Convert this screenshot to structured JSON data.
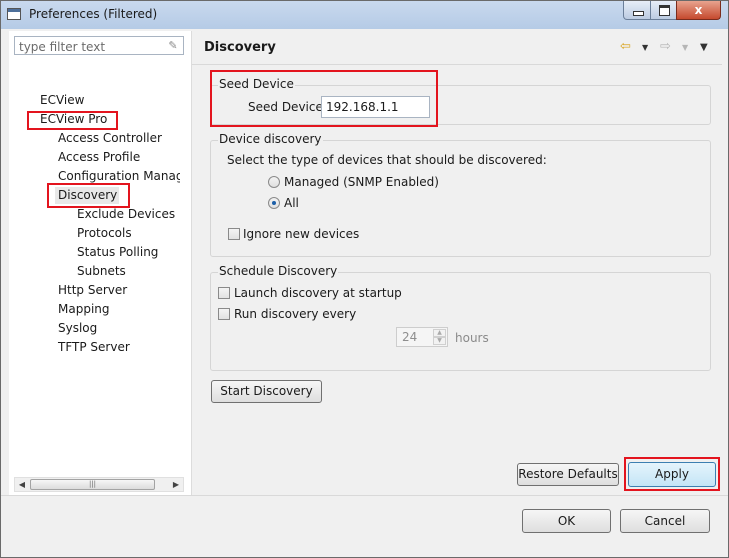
{
  "window": {
    "title": "Preferences (Filtered)",
    "close_glyph": "x"
  },
  "sidebar": {
    "filter_placeholder": "type filter text",
    "items": [
      {
        "label": "ECView"
      },
      {
        "label": "ECView Pro"
      },
      {
        "label": "Access Controller"
      },
      {
        "label": "Access Profile"
      },
      {
        "label": "Configuration Manag"
      },
      {
        "label": "Discovery"
      },
      {
        "label": "Exclude Devices"
      },
      {
        "label": "Protocols"
      },
      {
        "label": "Status Polling"
      },
      {
        "label": "Subnets"
      },
      {
        "label": "Http Server"
      },
      {
        "label": "Mapping"
      },
      {
        "label": "Syslog"
      },
      {
        "label": "TFTP Server"
      }
    ],
    "selected": "Discovery"
  },
  "page": {
    "title": "Discovery",
    "nav_icons": [
      "back-arrow-icon",
      "dropdown-icon",
      "forward-arrow-icon",
      "dropdown-icon",
      "view-menu-icon"
    ],
    "seed_device": {
      "group_title": "Seed Device",
      "label": "Seed Device",
      "value": "192.168.1.1"
    },
    "device_discovery": {
      "group_title": "Device discovery",
      "prompt": "Select the type of devices that should be discovered:",
      "options": [
        {
          "label": "Managed (SNMP Enabled)",
          "selected": false
        },
        {
          "label": "All",
          "selected": true
        }
      ],
      "ignore_new_devices": {
        "label": "Ignore new devices",
        "checked": false
      }
    },
    "schedule_discovery": {
      "group_title": "Schedule Discovery",
      "launch_at_startup": {
        "label": "Launch discovery at startup",
        "checked": false
      },
      "run_every": {
        "label": "Run discovery every",
        "checked": false
      },
      "interval_value": "24",
      "interval_unit": "hours"
    },
    "start_discovery_label": "Start Discovery",
    "restore_defaults_label": "Restore Defaults",
    "apply_label": "Apply"
  },
  "footer": {
    "ok_label": "OK",
    "cancel_label": "Cancel"
  },
  "colors": {
    "highlight": "#e3141e",
    "title_bar": "#b5cbe6",
    "radio_dot": "#1c5fa8"
  }
}
